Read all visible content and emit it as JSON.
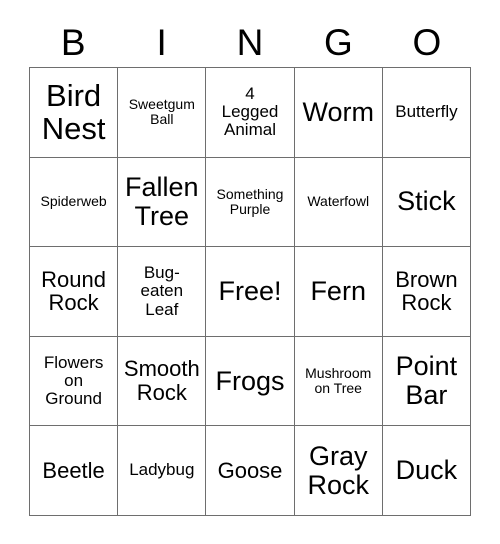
{
  "card": {
    "title": "BINGO Card",
    "background_color": "#ffffff",
    "grid_line_color": "#6e6e6e",
    "text_color": "#000000"
  },
  "header": {
    "letters": [
      {
        "label": "B"
      },
      {
        "label": "I"
      },
      {
        "label": "N"
      },
      {
        "label": "G"
      },
      {
        "label": "O"
      }
    ]
  },
  "grid": {
    "columns": 5,
    "rows": 5,
    "free_space": "Free!",
    "cells": [
      [
        {
          "text": "Bird\nNest",
          "size": "xl"
        },
        {
          "text": "Sweetgum\nBall",
          "size": "xs"
        },
        {
          "text": "4\nLegged\nAnimal",
          "size": "sm"
        },
        {
          "text": "Worm",
          "size": "lg"
        },
        {
          "text": "Butterfly",
          "size": "sm"
        }
      ],
      [
        {
          "text": "Spiderweb",
          "size": "xs"
        },
        {
          "text": "Fallen\nTree",
          "size": "lg"
        },
        {
          "text": "Something\nPurple",
          "size": "xs"
        },
        {
          "text": "Waterfowl",
          "size": "xs"
        },
        {
          "text": "Stick",
          "size": "lg"
        }
      ],
      [
        {
          "text": "Round\nRock",
          "size": "md"
        },
        {
          "text": "Bug-\neaten\nLeaf",
          "size": "sm"
        },
        {
          "text": "Free!",
          "size": "lg"
        },
        {
          "text": "Fern",
          "size": "lg"
        },
        {
          "text": "Brown\nRock",
          "size": "md"
        }
      ],
      [
        {
          "text": "Flowers\non\nGround",
          "size": "sm"
        },
        {
          "text": "Smooth\nRock",
          "size": "md"
        },
        {
          "text": "Frogs",
          "size": "lg"
        },
        {
          "text": "Mushroom\non Tree",
          "size": "xs"
        },
        {
          "text": "Point\nBar",
          "size": "lg"
        }
      ],
      [
        {
          "text": "Beetle",
          "size": "md"
        },
        {
          "text": "Ladybug",
          "size": "sm"
        },
        {
          "text": "Goose",
          "size": "md"
        },
        {
          "text": "Gray\nRock",
          "size": "lg"
        },
        {
          "text": "Duck",
          "size": "lg"
        }
      ]
    ]
  }
}
